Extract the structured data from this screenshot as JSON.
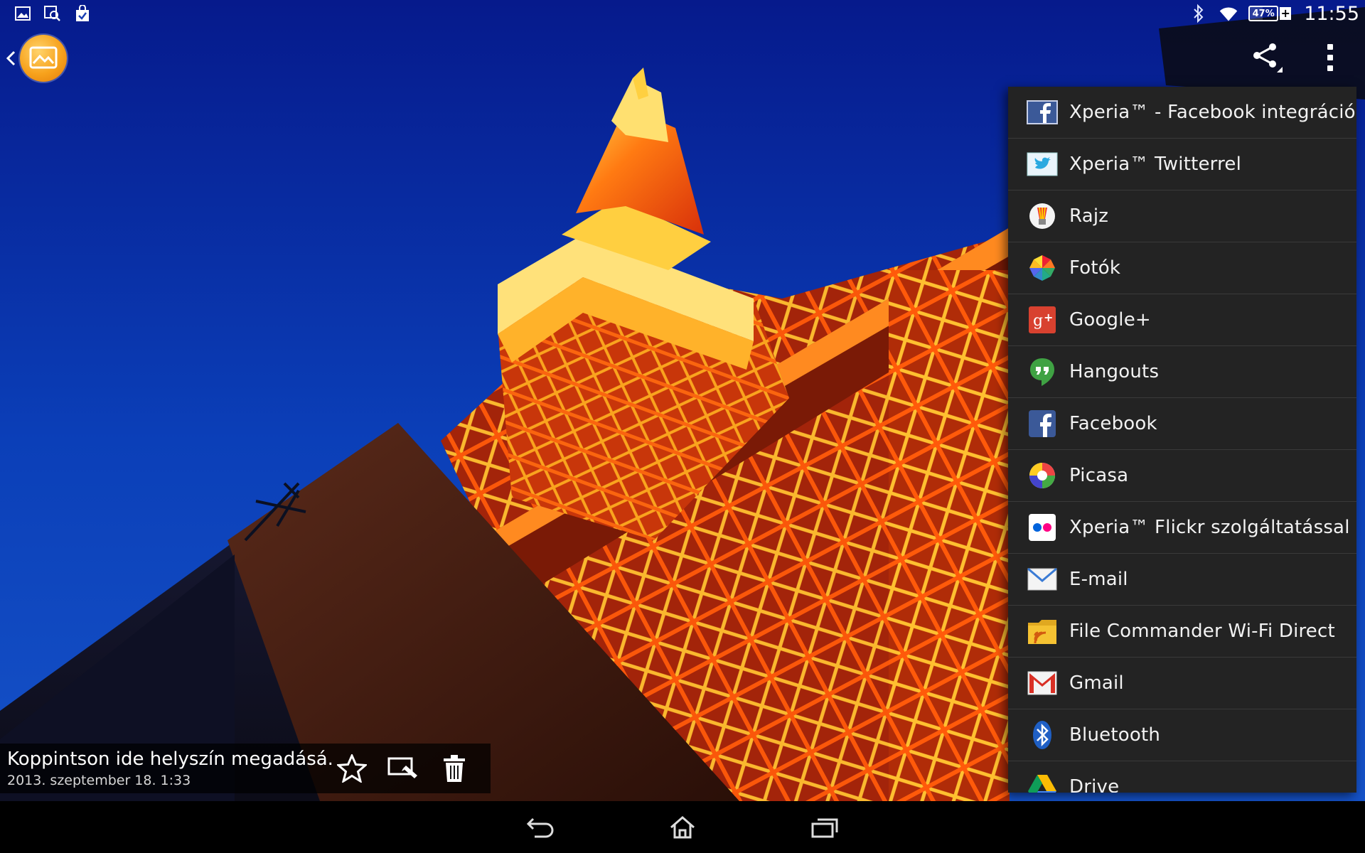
{
  "status_bar": {
    "notification_icons": [
      "image-icon",
      "screenshot-search-icon",
      "shopping-bag-icon"
    ],
    "system_icons": [
      "bluetooth-icon",
      "wifi-icon"
    ],
    "battery_label": "47%",
    "time": "11:55"
  },
  "action_bar": {
    "back_icon": "chevron-left-icon",
    "app_icon": "album-app-icon",
    "share_icon": "share-icon",
    "overflow_icon": "more-vertical-icon"
  },
  "share_menu": {
    "items": [
      {
        "label": "Xperia™ - Facebook integráció",
        "icon": "facebook-square-icon"
      },
      {
        "label": "Xperia™ Twitterrel",
        "icon": "twitter-icon"
      },
      {
        "label": "Rajz",
        "icon": "sketch-icon"
      },
      {
        "label": "Fotók",
        "icon": "photos-pinwheel-icon"
      },
      {
        "label": "Google+",
        "icon": "google-plus-icon"
      },
      {
        "label": "Hangouts",
        "icon": "hangouts-icon"
      },
      {
        "label": "Facebook",
        "icon": "facebook-icon"
      },
      {
        "label": "Picasa",
        "icon": "picasa-icon"
      },
      {
        "label": "Xperia™ Flickr szolgáltatással",
        "icon": "flickr-icon"
      },
      {
        "label": "E-mail",
        "icon": "email-icon"
      },
      {
        "label": "File Commander Wi-Fi Direct",
        "icon": "file-commander-icon"
      },
      {
        "label": "Gmail",
        "icon": "gmail-icon"
      },
      {
        "label": "Bluetooth",
        "icon": "bluetooth-icon"
      },
      {
        "label": "Drive",
        "icon": "drive-icon"
      }
    ]
  },
  "info_bar": {
    "location_prompt": "Koppintson ide helyszín megadásá...",
    "date": "2013. szeptember 18. 1:33",
    "actions": [
      "star-icon",
      "edit-icon",
      "trash-icon"
    ]
  },
  "nav_bar": {
    "buttons": [
      "back-icon",
      "home-icon",
      "recent-apps-icon"
    ]
  },
  "colors": {
    "sky": "#0a2fb0",
    "tower": "#ff5a0a",
    "menu_bg": "#232323",
    "menu_divider": "#3a3a3a"
  }
}
